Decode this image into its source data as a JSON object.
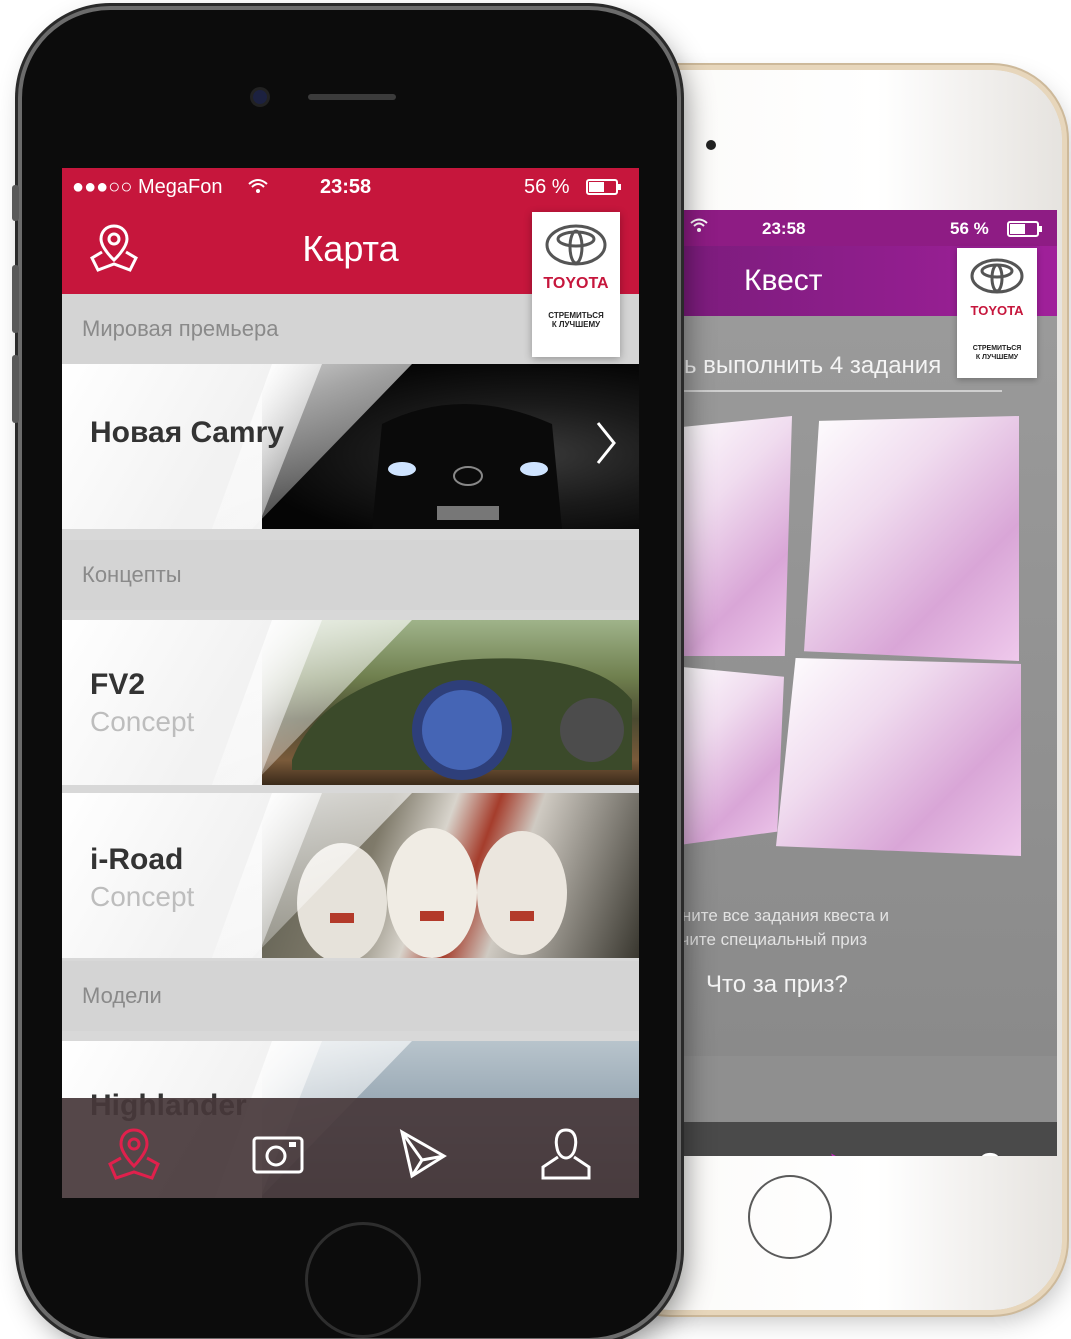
{
  "front": {
    "status": {
      "carrier": "●●●○○ MegaFon",
      "wifi": "wifi-icon",
      "time": "23:58",
      "battery": "56 %"
    },
    "header": {
      "title": "Карта",
      "left_icon": "map-pin-icon"
    },
    "brand": {
      "name": "TOYOTA",
      "tagline_1": "СТРЕМИТЬСЯ",
      "tagline_2": "К ЛУЧШЕМУ"
    },
    "sections": [
      {
        "label": "Мировая премьера"
      },
      {
        "label": "Концепты"
      },
      {
        "label": "Модели"
      }
    ],
    "cards": [
      {
        "name": "Новая Camry",
        "sub": ""
      },
      {
        "name": "FV2",
        "sub": "Concept"
      },
      {
        "name": "i-Road",
        "sub": "Concept"
      },
      {
        "name": "Highlander",
        "sub": ""
      }
    ],
    "tabs": [
      {
        "icon": "map-pin-icon",
        "active": true
      },
      {
        "icon": "camera-icon",
        "active": false
      },
      {
        "icon": "quest-icon",
        "active": false
      },
      {
        "icon": "user-icon",
        "active": false
      }
    ],
    "colors": {
      "accent": "#c6163c"
    }
  },
  "back": {
    "status": {
      "time": "23:58",
      "battery": "56 %"
    },
    "header": {
      "title": "Квест"
    },
    "brand": {
      "name": "TOYOTA",
      "tagline_1": "СТРЕМИТЬСЯ",
      "tagline_2": "К ЛУЧШЕМУ"
    },
    "quest_subtitle": "сь выполнить 4 задания",
    "desc_line_1": "лните все задания квеста и",
    "desc_line_2": "учите специальный приз",
    "prize_link": "Что за приз?",
    "colors": {
      "accent": "#8e1c84"
    }
  }
}
